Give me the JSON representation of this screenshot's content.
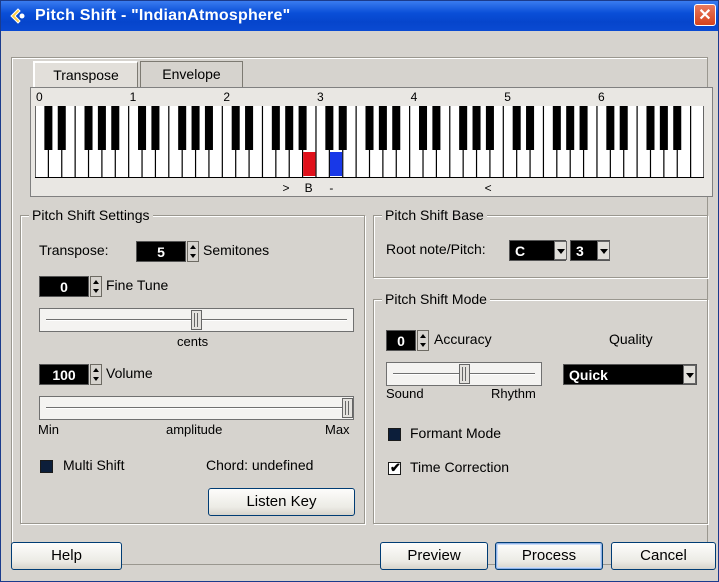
{
  "window": {
    "title": "Pitch Shift - \"IndianAtmosphere\"",
    "close_glyph": "✕"
  },
  "tabs": [
    {
      "label": "Transpose",
      "active": true
    },
    {
      "label": "Envelope",
      "active": false
    }
  ],
  "keyboard": {
    "octave_labels": [
      "0",
      "1",
      "2",
      "3",
      "4",
      "5",
      "6"
    ],
    "markers": [
      ">",
      "B",
      "-",
      "<"
    ],
    "root_key_color": "#e0101a",
    "target_key_color": "#1838e8"
  },
  "pitch_shift_settings": {
    "group_label": "Pitch Shift Settings",
    "transpose_label": "Transpose:",
    "transpose_value": "5",
    "semitones_label": "Semitones",
    "fine_tune_value": "0",
    "fine_tune_label": "Fine Tune",
    "cents_label": "cents",
    "cents_slider_value": 0.5,
    "volume_value": "100",
    "volume_label": "Volume",
    "amplitude_min": "Min",
    "amplitude_label": "amplitude",
    "amplitude_max": "Max",
    "amplitude_slider_value": 1.0,
    "multi_shift_label": "Multi Shift",
    "multi_shift_checked": false,
    "chord_text": "Chord: undefined",
    "listen_key_label": "Listen Key"
  },
  "pitch_shift_base": {
    "group_label": "Pitch Shift Base",
    "root_label": "Root note/Pitch:",
    "root_note": "C",
    "root_octave": "3"
  },
  "pitch_shift_mode": {
    "group_label": "Pitch Shift Mode",
    "accuracy_value": "0",
    "accuracy_label": "Accuracy",
    "quality_label": "Quality",
    "quality_value": "Quick",
    "sound_label": "Sound",
    "rhythm_label": "Rhythm",
    "accuracy_slider_value": 0.5,
    "formant_mode_label": "Formant Mode",
    "formant_mode_checked": false,
    "time_correction_label": "Time Correction",
    "time_correction_checked": true
  },
  "footer": {
    "help_label": "Help",
    "preview_label": "Preview",
    "process_label": "Process",
    "cancel_label": "Cancel"
  },
  "colors": {
    "title_bar": "#0a4fd8",
    "dialog_bg": "#d6d3ce",
    "spin_bg": "#000000"
  }
}
